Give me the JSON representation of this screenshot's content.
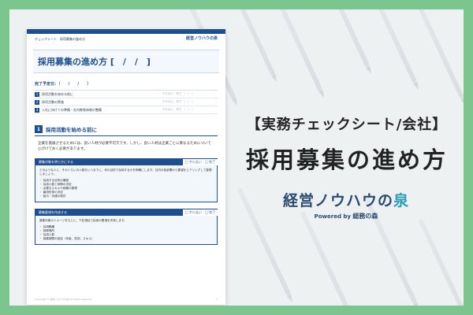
{
  "banner": {
    "label": "【実務チェックシート/会社】",
    "title": "採用募集の進め方",
    "logo_main_a": "経営ノウハウの",
    "logo_main_b": "泉",
    "logo_powered": "Powered by",
    "logo_brand": "総務の森"
  },
  "document": {
    "header_left": "チェックシート　採用募集の進め方",
    "header_right": "経営ノウハウの泉",
    "title": "採用募集の進め方",
    "title_date": "[　/　/　]",
    "due_label": "完了予定日：（　　/　　/　　）",
    "toc": [
      {
        "num": "1",
        "text": "採用活動を始める前に",
        "marks": "やらない　完了　/　/　/"
      },
      {
        "num": "2",
        "text": "採用活動の実施",
        "marks": "やらない　完了　/　/　/"
      },
      {
        "num": "3",
        "text": "入社に向けての準備・社内教育体制の整備",
        "marks": "やらない　完了　/　/　/"
      }
    ],
    "section1": {
      "num": "1",
      "title": "採用活動を始める前に",
      "text": "企業を発展させるためには、良い人材が必要不可欠です。しかし、良い人材は企業ごとに異なるためについて心がけておく必要があります。"
    },
    "tasks": [
      {
        "title": "募集対象を明らかにする",
        "check_no": "□ やらない",
        "check_done": "□ 完了",
        "body": "どのような人と、そのぐらいの人数をいつまでに、何の目的で採用するかを明確にします。社内の各部署から要望をヒアリングして整理しましょう。",
        "bullets": [
          "・ 採用する目的の確認",
          "・ 採用人数と時期の決定",
          "・ 必要なスキルや経験の整理",
          "・ 雇用形態の決定",
          "・ 給与・待遇の検討"
        ]
      },
      {
        "title": "募集要項を作成する",
        "check_no": "□ やらない",
        "check_done": "□ 完了",
        "body": "募集対象のイメージをもとに、下記項目で採用の要項を作成します。",
        "bullets": [
          "・ 採用職種",
          "・ 勤務場所",
          "・ 採用人数",
          "・ 募集期間の設定（年齢、性別、スキル）"
        ]
      }
    ],
    "footer_left": "Copyright © 経営ノウハウの泉 All rights reserved.",
    "footer_center": "1"
  }
}
